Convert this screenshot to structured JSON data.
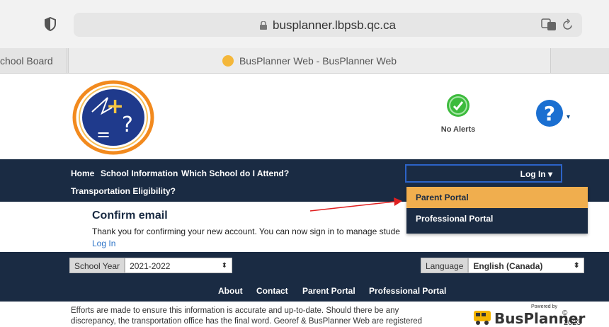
{
  "browser": {
    "url": "busplanner.lbpsb.qc.ca",
    "tab_inactive_label": "chool Board",
    "tab_active_label": "BusPlanner Web - BusPlanner Web"
  },
  "header": {
    "alerts_label": "No Alerts"
  },
  "nav": {
    "links": [
      "Home",
      "School Information",
      "Which School do I Attend?",
      "Transportation Eligibility?"
    ],
    "login_label": "Log In",
    "dropdown": [
      "Parent Portal",
      "Professional Portal"
    ]
  },
  "content": {
    "title": "Confirm email",
    "text": "Thank you for confirming your new account. You can now sign in to manage stude",
    "link": "Log In"
  },
  "footer": {
    "school_year_label": "School Year",
    "school_year_value": "2021-2022",
    "language_label": "Language",
    "language_value": "English (Canada)",
    "links": [
      "About",
      "Contact",
      "Parent Portal",
      "Professional Portal"
    ]
  },
  "disclaimer": {
    "line1": "Efforts are made to ensure this information is accurate and up-to-date. Should there be any",
    "line2": "discrepancy, the transportation office has the final word. Georef & BusPlanner Web are registered"
  },
  "brand": {
    "powered_by": "Powered by",
    "name": "BusPlanner",
    "copyright": "©",
    "year": "2023"
  },
  "colors": {
    "navbar": "#1a2b43",
    "dropdown_active": "#f0ae4e",
    "link": "#2a72c7",
    "alerts_green": "#3dbb3d",
    "help_blue": "#1a6fd1"
  }
}
